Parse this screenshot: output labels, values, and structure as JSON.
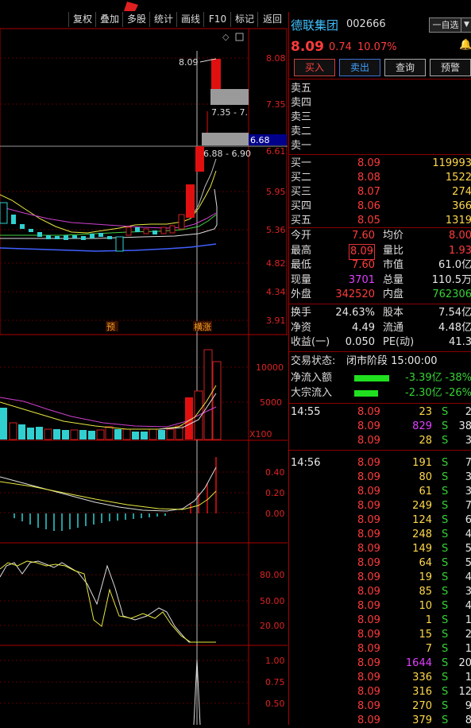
{
  "toolbar": [
    "复权",
    "叠加",
    "多股",
    "统计",
    "画线",
    "F10",
    "标记",
    "返回"
  ],
  "stock": {
    "name": "德联集团",
    "code": "002666",
    "price": "8.09",
    "change": "0.74",
    "pct": "10.07%",
    "watch": "一自选"
  },
  "actions": [
    "买入",
    "卖出",
    "查询",
    "预警"
  ],
  "sell": [
    "卖五",
    "卖四",
    "卖三",
    "卖二",
    "卖一"
  ],
  "buy": [
    {
      "label": "买一",
      "price": "8.09",
      "vol": "119993"
    },
    {
      "label": "买二",
      "price": "8.08",
      "vol": "1522"
    },
    {
      "label": "买三",
      "price": "8.07",
      "vol": "274"
    },
    {
      "label": "买四",
      "price": "8.06",
      "vol": "366"
    },
    {
      "label": "买五",
      "price": "8.05",
      "vol": "1319"
    }
  ],
  "stats": [
    {
      "l1": "今开",
      "v1": "7.60",
      "l2": "均价",
      "v2": "8.00"
    },
    {
      "l1": "最高",
      "v1": "8.09",
      "l2": "量比",
      "v2": "1.93"
    },
    {
      "l1": "最低",
      "v1": "7.60",
      "l2": "市值",
      "v2": "61.0亿"
    },
    {
      "l1": "现量",
      "v1": "3701",
      "l2": "总量",
      "v2": "110.5万"
    },
    {
      "l1": "外盘",
      "v1": "342520",
      "l2": "内盘",
      "v2": "762306"
    }
  ],
  "stats2": [
    {
      "l1": "换手",
      "v1": "24.63%",
      "l2": "股本",
      "v2": "7.54亿"
    },
    {
      "l1": "净资",
      "v1": "4.49",
      "l2": "流通",
      "v2": "4.48亿"
    },
    {
      "l1": "收益(一)",
      "v1": "0.050",
      "l2": "PE(动)",
      "v2": "41.3"
    }
  ],
  "status": {
    "label": "交易状态:",
    "value": "闭市阶段 15:00:00"
  },
  "flows": [
    {
      "label": "净流入额",
      "value": "-3.39亿",
      "pct": "-38%"
    },
    {
      "label": "大宗流入",
      "value": "-2.30亿",
      "pct": "-26%"
    }
  ],
  "ticks1": {
    "time": "14:55",
    "rows": [
      [
        "8.09",
        "23",
        "S",
        "2"
      ],
      [
        "8.09",
        "829",
        "S",
        "38"
      ],
      [
        "8.09",
        "28",
        "S",
        "3"
      ]
    ]
  },
  "ticks2": {
    "time": "14:56",
    "rows": [
      [
        "8.09",
        "191",
        "S",
        "7"
      ],
      [
        "8.09",
        "80",
        "S",
        "3"
      ],
      [
        "8.09",
        "61",
        "S",
        "3"
      ],
      [
        "8.09",
        "249",
        "S",
        "7"
      ],
      [
        "8.09",
        "124",
        "S",
        "6"
      ],
      [
        "8.09",
        "248",
        "S",
        "4"
      ],
      [
        "8.09",
        "149",
        "S",
        "5"
      ],
      [
        "8.09",
        "64",
        "S",
        "5"
      ],
      [
        "8.09",
        "19",
        "S",
        "4"
      ],
      [
        "8.09",
        "85",
        "S",
        "3"
      ],
      [
        "8.09",
        "10",
        "S",
        "4"
      ],
      [
        "8.09",
        "1",
        "S",
        "1"
      ],
      [
        "8.09",
        "15",
        "S",
        "2"
      ],
      [
        "8.09",
        "7",
        "S",
        "1"
      ],
      [
        "8.09",
        "1644",
        "S",
        "20"
      ],
      [
        "8.09",
        "336",
        "S",
        "1"
      ],
      [
        "8.09",
        "316",
        "S",
        "12"
      ],
      [
        "8.09",
        "270",
        "S",
        "9"
      ],
      [
        "8.09",
        "379",
        "S",
        "8"
      ]
    ]
  },
  "chart": {
    "price_ticks": [
      "8.08",
      "7.35",
      "6.61",
      "5.95",
      "5.36",
      "4.82",
      "4.34",
      "3.91"
    ],
    "vol_ticks": [
      "10000",
      "5000"
    ],
    "vol_unit": "X100",
    "macd_ticks": [
      "0.40",
      "0.20",
      "0.00"
    ],
    "kdj_ticks": [
      "80.00",
      "50.00",
      "20.00"
    ],
    "ind_ticks": [
      "1.00",
      "0.75",
      "0.50"
    ],
    "last_price": "6.68",
    "ann_high": "8.09",
    "ann_range1": "7.35 - 7.",
    "ann_range2": "6.88 - 6.90",
    "tag1": "预",
    "tag2": "横涨"
  }
}
